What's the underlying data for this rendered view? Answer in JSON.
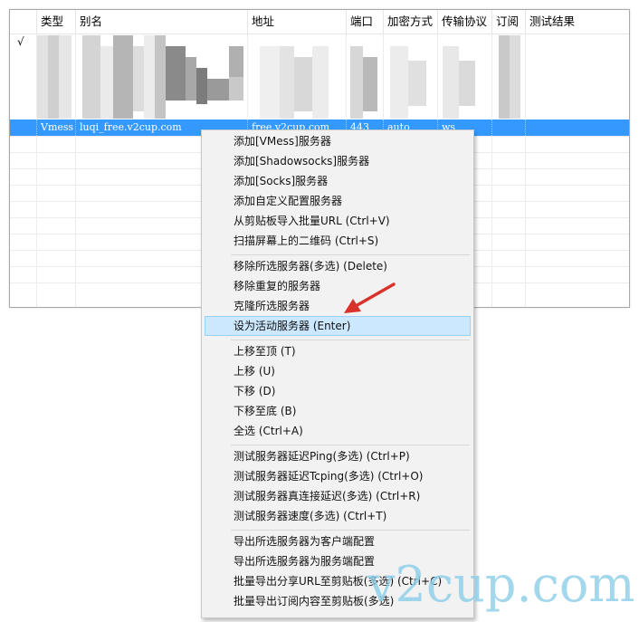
{
  "table": {
    "columns": [
      "",
      "类型",
      "别名",
      "地址",
      "端口",
      "加密方式",
      "传输协议",
      "订阅",
      "测试结果"
    ],
    "checkmark": "√",
    "selected_row": [
      "",
      "Vmess",
      "luqi_free.v2cup.com",
      "free.v2cup.com",
      "443",
      "auto",
      "ws",
      "",
      ""
    ]
  },
  "context_menu": {
    "group1": [
      "添加[VMess]服务器",
      "添加[Shadowsocks]服务器",
      "添加[Socks]服务器",
      "添加自定义配置服务器",
      "从剪贴板导入批量URL (Ctrl+V)",
      "扫描屏幕上的二维码 (Ctrl+S)"
    ],
    "group2": [
      "移除所选服务器(多选) (Delete)",
      "移除重复的服务器",
      "克隆所选服务器",
      "设为活动服务器 (Enter)"
    ],
    "group3": [
      "上移至顶 (T)",
      "上移 (U)",
      "下移 (D)",
      "下移至底 (B)",
      "全选 (Ctrl+A)"
    ],
    "group4": [
      "测试服务器延迟Ping(多选) (Ctrl+P)",
      "测试服务器延迟Tcping(多选) (Ctrl+O)",
      "测试服务器真连接延迟(多选) (Ctrl+R)",
      "测试服务器速度(多选) (Ctrl+T)"
    ],
    "group5": [
      "导出所选服务器为客户端配置",
      "导出所选服务器为服务端配置",
      "批量导出分享URL至剪贴板(多选) (Ctrl+C)",
      "批量导出订阅内容至剪贴板(多选)"
    ],
    "highlighted_item": "设为活动服务器 (Enter)"
  },
  "watermark": "v2cup.com",
  "colors": {
    "selection": "#3399ff",
    "menu_highlight": "#cce8ff",
    "arrow": "#d9322b",
    "watermark": "#8ecfe9"
  }
}
